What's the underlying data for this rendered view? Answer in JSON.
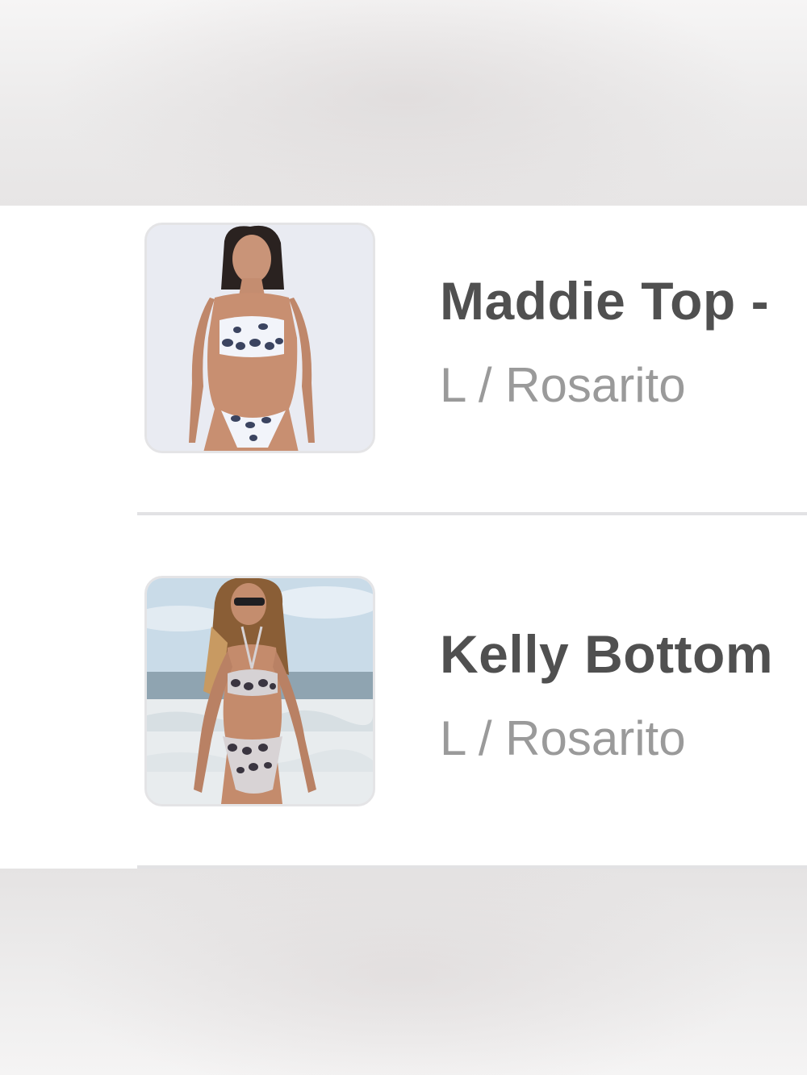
{
  "cart_items": [
    {
      "title": "Maddie Top -",
      "variant": "L / Rosarito",
      "image": "product-photo-model-studio"
    },
    {
      "title": "Kelly Bottom",
      "variant": "L / Rosarito",
      "image": "product-photo-model-beach"
    }
  ],
  "colors": {
    "title": "#505050",
    "variant": "#9a9a9a",
    "divider": "#e2e2e4",
    "thumb_border": "#e4e4e6"
  }
}
